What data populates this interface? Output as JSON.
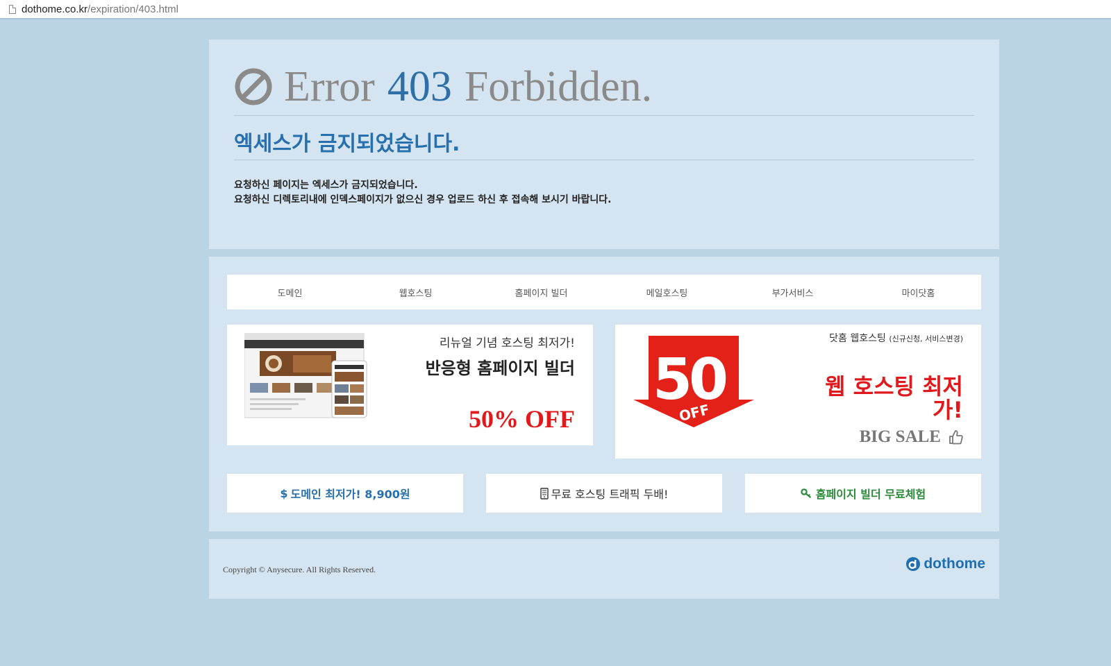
{
  "browser": {
    "url_host": "dothome.co.kr",
    "url_path": "/expiration/403.html"
  },
  "error": {
    "title_prefix": "Error",
    "title_code": "403",
    "title_suffix": "Forbidden.",
    "subtitle": "엑세스가 금지되었습니다.",
    "description_line1": "요청하신 페이지는 엑세스가 금지되었습니다.",
    "description_line2": "요청하신 디렉토리내에 인덱스페이지가 없으신 경우 업로드 하신 후 접속해 보시기 바랍니다."
  },
  "nav": {
    "items": [
      "도메인",
      "웹호스팅",
      "홈페이지 빌더",
      "메일호스팅",
      "부가서비스",
      "마이닷홈"
    ]
  },
  "banner_builder": {
    "line1": "리뉴얼 기념 호스팅 최저가!",
    "line2": "반응형 홈페이지 빌더",
    "line3": "50% OFF"
  },
  "banner_hosting": {
    "badge_number": "50",
    "badge_percent": "%",
    "badge_off": "OFF",
    "line1": "닷홈 웹호스팅",
    "line1_small": "(신규신청, 서비스변경)",
    "line2": "웹 호스팅 최저가!",
    "line3": "BIG SALE"
  },
  "promos": {
    "domain_icon": "$",
    "domain": "도메인 최저가! 8,900원",
    "hosting": "무료 호스팅 트래픽 두배!",
    "builder": "홈페이지 빌더 무료체험"
  },
  "footer": {
    "copyright": "Copyright © Anysecure. All Rights Reserved.",
    "brand": "dothome"
  },
  "colors": {
    "background": "#bad3e5",
    "panel": "#d4e5f1",
    "accent_blue": "#2770ad",
    "sale_red": "#e0191c",
    "builder_green": "#2a8a3a"
  }
}
